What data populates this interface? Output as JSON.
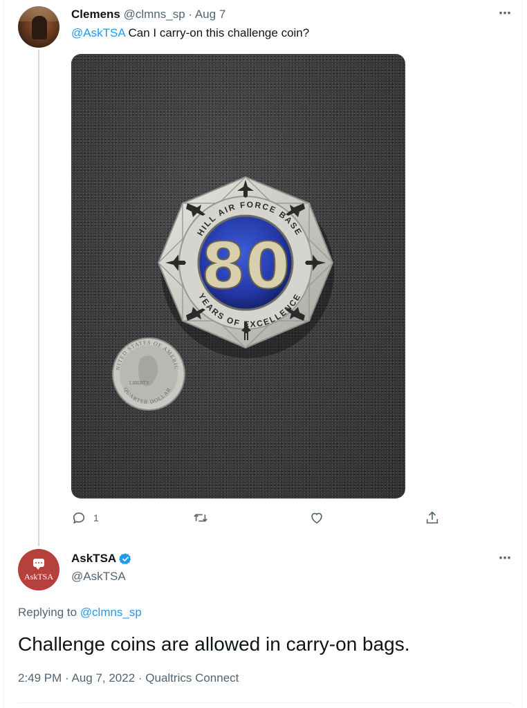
{
  "original_tweet": {
    "author_name": "Clemens",
    "author_handle": "@clmns_sp",
    "separator": " · ",
    "date": "Aug 7",
    "mention": "@AskTSA",
    "text": " Can I carry-on this challenge coin?",
    "more_icon": "⋯",
    "media": {
      "coin": {
        "number": "80",
        "ring_top": "HILL AIR FORCE BASE",
        "ring_bottom": "YEARS OF EXCELLENCE"
      },
      "quarter": {
        "ring": "UNITED STATES OF AMERICA",
        "liberty": "LIBERTY",
        "bottom": "QUARTER DOLLAR"
      }
    },
    "actions": {
      "reply_count": "1",
      "icons": [
        "reply-icon",
        "retweet-icon",
        "like-icon",
        "share-icon"
      ]
    }
  },
  "reply_tweet": {
    "avatar_label": "AskTSA",
    "author_name": "AskTSA",
    "verified": true,
    "author_handle": "@AskTSA",
    "more_icon": "⋯",
    "replying_prefix": "Replying to ",
    "replying_handle": "@clmns_sp",
    "text": "Challenge coins are allowed in carry-on bags.",
    "timestamp": "2:49 PM · Aug 7, 2022 · Qualtrics Connect"
  },
  "colors": {
    "accent": "#1d9bf0",
    "secondary_text": "#536471",
    "primary_text": "#0f1419",
    "avatar_red": "#b5403c"
  }
}
